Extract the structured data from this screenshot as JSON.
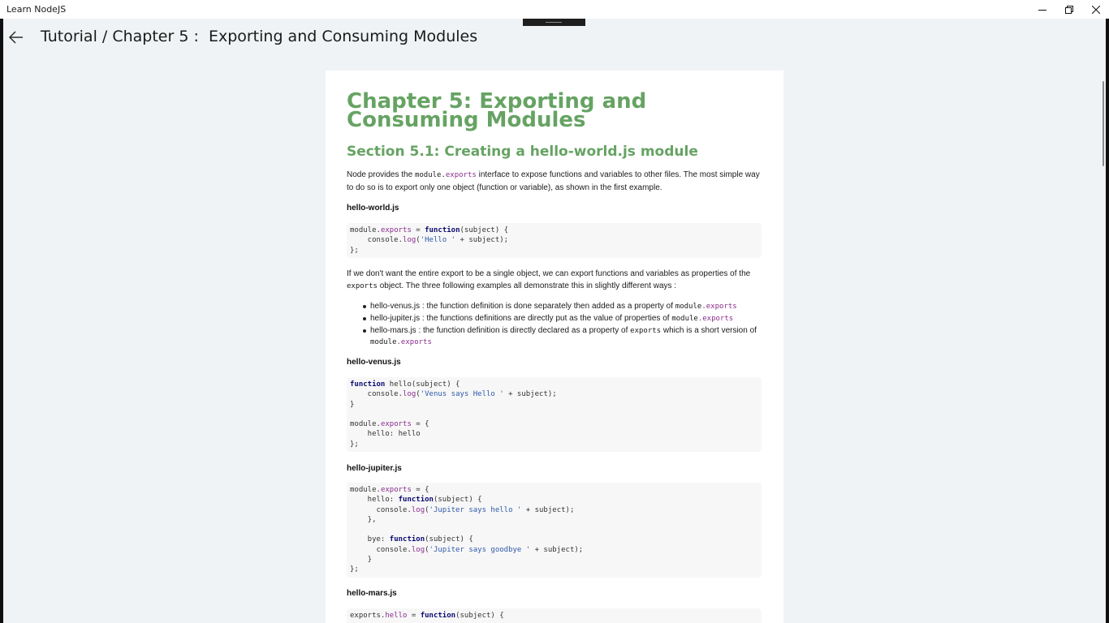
{
  "window": {
    "app_title": "Learn NodeJS"
  },
  "header": {
    "breadcrumb": "Tutorial / Chapter 5 :  Exporting and Consuming Modules"
  },
  "doc": {
    "chapter_title": "Chapter 5: Exporting and Consuming Modules",
    "section_title": "Section 5.1: Creating a hello-world.js module",
    "intro": {
      "before": "Node provides the ",
      "code_obj": "module",
      "code_dot": ".",
      "code_prop": "exports",
      "after": " interface to expose functions and variables to other files. The most simple way to do so is to export only one object (function or variable), as shown in the first example."
    },
    "file1": "hello-world.js",
    "para2": {
      "before": "If we don't want the entire export to be a single object, we can export functions and variables as properties of the ",
      "code": "exports",
      "after": " object. The three following examples all demonstrate this in slightly different ways :"
    },
    "bullets": [
      {
        "text": "hello-venus.js : the function definition is done separately then added as a property of ",
        "code_obj": "module",
        "code_prop": ".exports",
        "code_extra": ""
      },
      {
        "text": "hello-jupiter.js : the functions definitions are directly put as the value of properties of ",
        "code_obj": "module",
        "code_prop": ".exports",
        "code_extra": ""
      },
      {
        "text": "hello-mars.js : the function definition is directly declared as a property of ",
        "code_obj": "exports",
        "code_prop": "",
        "code_extra": " which is a short version of",
        "tail_obj": "module",
        "tail_prop": ".exports"
      }
    ],
    "file2": "hello-venus.js",
    "file3": "hello-jupiter.js",
    "file4": "hello-mars.js"
  },
  "code": {
    "hello_world": [
      "module.exports = function(subject) {",
      "    console.log('Hello ' + subject);",
      "};"
    ],
    "hello_venus": [
      "function hello(subject) {",
      "    console.log('Venus says Hello ' + subject);",
      "}",
      "",
      "module.exports = {",
      "    hello: hello",
      "};"
    ],
    "hello_jupiter": [
      "module.exports = {",
      "    hello: function(subject) {",
      "      console.log('Jupiter says hello ' + subject);",
      "    },",
      "",
      "    bye: function(subject) {",
      "      console.log('Jupiter says goodbye ' + subject);",
      "    }",
      "};"
    ],
    "hello_mars": [
      "exports.hello = function(subject) {"
    ]
  },
  "colors": {
    "heading_green": "#66a363",
    "keyword": "#0a0a70",
    "property": "#8a2d8e",
    "string": "#2e5aab",
    "page_bg": "#eff3f5"
  }
}
